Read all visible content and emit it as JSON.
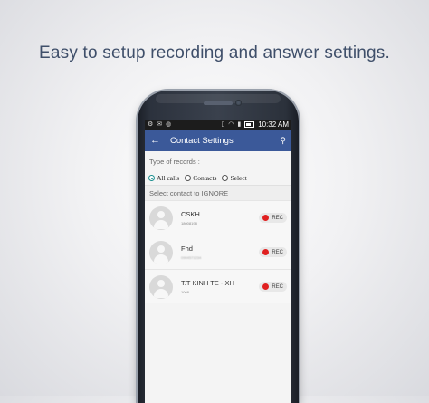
{
  "headline": "Easy to setup recording and answer settings.",
  "statusbar": {
    "time": "10:32 AM",
    "signal": "▮▮▮",
    "wifi": "≋"
  },
  "appbar": {
    "title": "Contact Settings"
  },
  "type_of_records": {
    "label": "Type of records :",
    "options": [
      {
        "label": "All calls",
        "checked": true
      },
      {
        "label": "Contacts",
        "checked": false
      },
      {
        "label": "Select",
        "checked": false
      }
    ]
  },
  "ignore_label": "Select contact to IGNORE",
  "contacts": [
    {
      "name": "CSKH",
      "number": "18008198",
      "rec_label": "REC"
    },
    {
      "name": "Fhd",
      "number": "0904571234",
      "rec_label": "REC"
    },
    {
      "name": "T.T KINH TE - XH",
      "number": "1068",
      "rec_label": "REC"
    }
  ],
  "colors": {
    "appbar": "#3b5999",
    "rec": "#e02020",
    "radio": "#1a8e8e"
  }
}
